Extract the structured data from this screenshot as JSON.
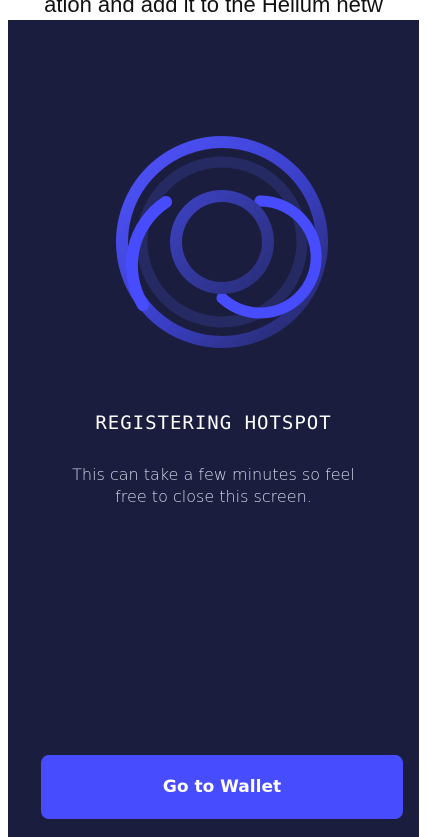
{
  "top_caption": "ation and add it to the Helium netw",
  "status": {
    "title": "REGISTERING HOTSPOT",
    "message": "This can take a few minutes so feel free to close this screen."
  },
  "actions": {
    "go_to_wallet_label": "Go to Wallet"
  },
  "colors": {
    "background": "#1b1d3f",
    "accent": "#474dff",
    "text": "#ffffff"
  },
  "icons": {
    "loading": "concentric-spinner-icon"
  }
}
